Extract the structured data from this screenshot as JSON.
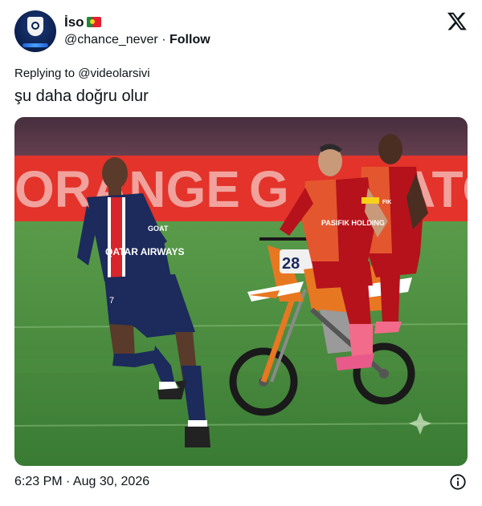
{
  "author": {
    "display_name": "İso",
    "flag_icon": "portugal-flag-icon",
    "handle": "@chance_never",
    "separator": "·",
    "follow_label": "Follow"
  },
  "platform_icon": "x-logo-icon",
  "reply": {
    "text": "Replying to @videolarsivi"
  },
  "tweet": {
    "text": "şu daha doğru olur"
  },
  "media": {
    "banner_text": "ORANGE",
    "left_player_number": "7",
    "left_sponsor": "QATAR AIRWAYS",
    "left_chest_text": "GOAT",
    "right_sponsor": "PASIFIK HOLDING",
    "bike_number": "28"
  },
  "footer": {
    "timestamp": "6:23 PM · Aug 30, 2026",
    "info_icon": "info-icon"
  },
  "colors": {
    "psg_navy": "#1c2a5c",
    "gs_orange": "#e4572e",
    "gs_red": "#b5121b",
    "pitch_green": "#3f8a3a",
    "banner_red": "#e3332a"
  }
}
